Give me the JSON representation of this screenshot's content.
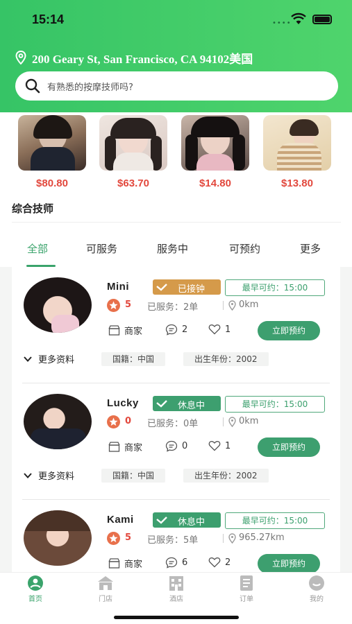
{
  "status_bar": {
    "time": "15:14"
  },
  "location": {
    "address": "200 Geary St, San Francisco, CA 94102美国"
  },
  "search": {
    "placeholder": "有熟悉的按摩技师吗?"
  },
  "featured": [
    {
      "price": "$80.80"
    },
    {
      "price": "$63.70"
    },
    {
      "price": "$14.80"
    },
    {
      "price": "$13.80"
    }
  ],
  "section_title": "综合技师",
  "tabs": [
    {
      "label": "全部",
      "active": true
    },
    {
      "label": "可服务",
      "active": false
    },
    {
      "label": "服务中",
      "active": false
    },
    {
      "label": "可预约",
      "active": false
    },
    {
      "label": "更多",
      "active": false
    }
  ],
  "technicians": [
    {
      "name": "Mini",
      "status": "已接钟",
      "status_color": "#d59a4a",
      "earliest": "最早可约：15:00",
      "rating": "5",
      "served": "已服务：2单",
      "distance": "0km",
      "merchant": "商家",
      "comments": "2",
      "likes": "1",
      "book": "立即预约",
      "more": "更多资料",
      "nationality": "国籍：中国",
      "birth_year": "出生年份：2002"
    },
    {
      "name": "Lucky",
      "status": "休息中",
      "status_color": "#3d9f6f",
      "earliest": "最早可约：15:00",
      "rating": "0",
      "served": "已服务：0单",
      "distance": "0km",
      "merchant": "商家",
      "comments": "0",
      "likes": "1",
      "book": "立即预约",
      "more": "更多资料",
      "nationality": "国籍：中国",
      "birth_year": "出生年份：2002"
    },
    {
      "name": "Kami",
      "status": "休息中",
      "status_color": "#3d9f6f",
      "earliest": "最早可约：15:00",
      "rating": "5",
      "served": "已服务：5单",
      "distance": "965.27km",
      "merchant": "商家",
      "comments": "6",
      "likes": "2",
      "book": "立即预约"
    }
  ],
  "tabbar": [
    {
      "label": "首页",
      "icon": "home-person-icon",
      "active": true
    },
    {
      "label": "门店",
      "icon": "store-icon",
      "active": false
    },
    {
      "label": "酒店",
      "icon": "hotel-icon",
      "active": false
    },
    {
      "label": "订单",
      "icon": "order-icon",
      "active": false
    },
    {
      "label": "我的",
      "icon": "profile-icon",
      "active": false
    }
  ],
  "colors": {
    "brand_green": "#3d9f6f",
    "header_green": "#41c96a",
    "price_red": "#e2483d"
  }
}
